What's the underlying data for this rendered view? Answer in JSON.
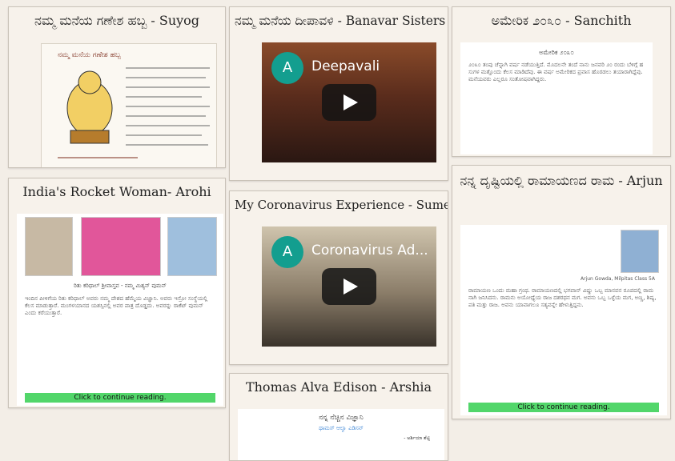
{
  "cards": {
    "c1": {
      "title": "ನಮ್ಮ ಮನೆಯ ಗಣೇಶ ಹಬ್ಬ - Suyog"
    },
    "c2": {
      "title": "ನಮ್ಮ ಮನೆಯ ದೀಪಾವಳಿ - Banavar Sisters",
      "video_title": "Deepavali",
      "avatar_letter": "A"
    },
    "c3": {
      "title": "ಅಮೇರಿಕ ೨೦೩೦ - Sanchith",
      "doc_heading": "ಅಮೇರಿಕ ೨೦೩೦",
      "doc_body": "೨೦೩೦ ತಂಪು ಚೆನ್ನಾಗಿ ವರ್ಷ ನಡೆಯುತ್ತಿದೆ. ಮೊದಲನೇ ತಂದೆ ನಾನು ಜನವರಿ ೨೦ ರಂದು ಬೆಳಿಗ್ಗೆ ಹಸುಗಳ ಮತ್ತೊಂದು ಕೆಲಸ ಮಾಡಿದೆವು. ಈ ವರ್ಷ ಅಮೇರಿಕದ ಪ್ರವಾಸ ಹೊರಡಲು ತಯಾರಾಗಿದ್ದೆವು. ಮನೆಯವರು ಎಲ್ಲರೂ ಸಂತೋಷವಾಗಿದ್ದರು."
    },
    "c4": {
      "title": "India's Rocket Woman- Arohi",
      "doc_heading": "ರಿತು ಕರಿಧಾಲ್ ಶ್ರೀವಾಸ್ತವ - ನಮ್ಮ ಮಿಶ್ಯನ್ ವುಮನ್",
      "doc_body": "ಇಂದಿನ ಪೀಳಿಗೆಯ ರಿತು ಕರಿಧಾಲ್ ಅವರು ನಮ್ಮ ದೇಶದ ಹೆಮ್ಮೆಯ ವಿಜ್ಞಾನಿ. ಅವರು ಇಸ್ರೋ ಸಂಸ್ಥೆಯಲ್ಲಿ ಕೆಲಸ ಮಾಡುತ್ತಾರೆ. ಮಂಗಳಯಾನದ ಯಶಸ್ಸಿನಲ್ಲಿ ಅವರ ಪಾತ್ರ ದೊಡ್ಡದು. ಅವರನ್ನು ರಾಕೆಟ್ ವುಮನ್ ಎಂದು ಕರೆಯುತ್ತಾರೆ.",
      "continue_label": "Click to continue reading."
    },
    "c5": {
      "title": "My Coronavirus Experience - Sumedha",
      "video_title": "Coronavirus Ad...",
      "avatar_letter": "A"
    },
    "c6": {
      "title": "ನನ್ನ ದೃಷ್ಟಿಯಲ್ಲಿ ರಾಮಾಯಣದ ರಾಮ - Arjun",
      "author_caption": "Arjun Gowda, Milpitas Class 5A",
      "doc_body": "ರಾಮಾಯಣ ಒಂದು ಮಹಾ ಗ್ರಂಥ. ರಾಮಾಯಣದಲ್ಲಿ ಭಗವಾನ್ ವಿಷ್ಣು ಒಬ್ಬ ಮಾನವನ ರೂಪದಲ್ಲಿ ರಾಮನಾಗಿ ಜನಿಸಿದನು. ರಾಮನು ಅಯೋಧ್ಯೆಯ ರಾಜ ದಶರಥನ ಮಗ. ಅವನು ಒಬ್ಬ ಒಳ್ಳೆಯ ಮಗ, ಅಣ್ಣ, ಶಿಷ್ಯ, ಪತಿ ಮತ್ತು ರಾಜ. ಅವನು ಯಾವಾಗಲೂ ಸತ್ಯವನ್ನೇ ಹೇಳುತ್ತಿದ್ದನು.",
      "continue_label": "Click to continue reading."
    },
    "c7": {
      "title": "Thomas Alva Edison - Arshia",
      "doc_heading": "ನನ್ನ ನೆಚ್ಚಿನ ವಿಜ್ಞಾನಿ",
      "doc_sub": "ಥಾಮಸ್ ಆಲ್ವಾ ಎಡಿಸನ್",
      "doc_author": "- ಅರ್ಶಿಯಾ ಶೆಟ್ಟಿ"
    }
  }
}
